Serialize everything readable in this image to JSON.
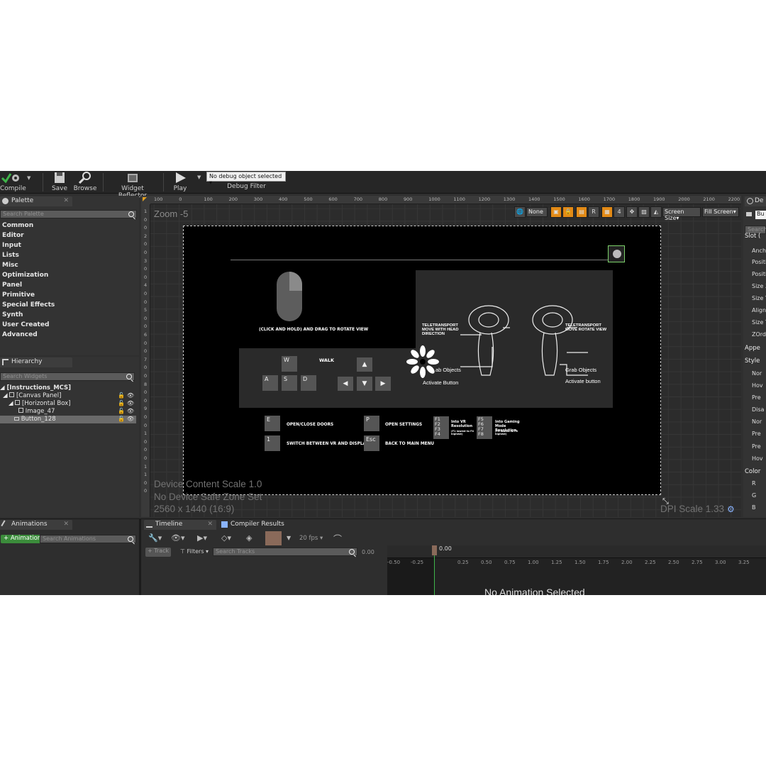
{
  "toolbar": {
    "compile": "Compile",
    "save": "Save",
    "browse": "Browse",
    "widget_reflector": "Widget Reflector",
    "play": "Play",
    "debug_object": "No debug object selected",
    "debug_filter": "Debug Filter"
  },
  "palette": {
    "tab": "Palette",
    "search_placeholder": "Search Palette",
    "items": [
      "Common",
      "Editor",
      "Input",
      "Lists",
      "Misc",
      "Optimization",
      "Panel",
      "Primitive",
      "Special Effects",
      "Synth",
      "User Created",
      "Advanced"
    ]
  },
  "hierarchy": {
    "tab": "Hierarchy",
    "search_placeholder": "Search Widgets",
    "rows": [
      "[Instructions_MCS]",
      "[Canvas Panel]",
      "[Horizontal Box]",
      "Image_47",
      "Button_128"
    ]
  },
  "designer": {
    "zoom": "Zoom -5",
    "ruler_ticks": [
      "100",
      "0",
      "100",
      "200",
      "300",
      "400",
      "500",
      "600",
      "700",
      "800",
      "900",
      "1000",
      "1100",
      "1200",
      "1300",
      "1400",
      "1500",
      "1600",
      "1700",
      "1800",
      "1900",
      "2000",
      "2100",
      "2200"
    ],
    "ruler_vticks": [
      "1",
      "0",
      "0",
      "2",
      "0",
      "0",
      "3",
      "0",
      "0",
      "4",
      "0",
      "0",
      "5",
      "0",
      "0",
      "6",
      "0",
      "0",
      "7",
      "0",
      "0",
      "8",
      "0",
      "0",
      "9",
      "0",
      "0",
      "1",
      "0",
      "0",
      "0",
      "1",
      "1",
      "0",
      "0"
    ],
    "view_none": "None",
    "view_r": "R",
    "view_4": "4",
    "screen_size": "Screen Size",
    "fill_screen": "Fill Screen",
    "device_content_scale": "Device Content Scale 1.0",
    "safe_zone": "No Device Safe Zone Set",
    "resolution": "2560 x 1440 (16:9)",
    "dpi_scale": "DPI Scale 1.33"
  },
  "instructions": {
    "mouse_text": "(CLICK AND HOLD) AND DRAG TO ROTATE VIEW",
    "walk": "WALK",
    "keys": [
      "W",
      "A",
      "S",
      "D"
    ],
    "arrows": [
      "▲",
      "◀",
      "▼",
      "▶"
    ],
    "tele_left": "TELETRANSPORT MOVE WITH HEAD DIRECTION",
    "tele_right": "TELETRANSPORT MOVE ROTATE VIEW",
    "grab_left": "ab Objects",
    "activate_left": "Activate Button",
    "grab_right": "Grab Objects",
    "activate_right": "Activate button",
    "key_e": "E",
    "open_close": "OPEN/CLOSE  DOORS",
    "key_p": "P",
    "open_settings": "OPEN SETTINGS",
    "key_1": "1",
    "switch_vr": "SWITCH BETWEEN VR AND DISPLAY",
    "key_esc": "Esc",
    "back_menu": "BACK TO MAIN MENU",
    "f1_keys": "F1\nF2\nF3\nF4",
    "vr_res": "Into VR Resolution",
    "vr_res_note": "(F1 lowest to F4 highest)",
    "f5_keys": "F5\nF6\nF7\nF8",
    "gaming_res": "Into Gaming Mode Resolution",
    "gaming_res_note": "(F5 lowest to F8 highest)"
  },
  "details": {
    "tab": "De",
    "button": "Bu",
    "search": "Search",
    "rows": [
      "Slot (",
      "Ancho",
      "Positi",
      "Positi",
      "Size X",
      "Size Y",
      "Align",
      "Size T",
      "ZOrde",
      "Appe",
      "Style",
      "Nor",
      "Hov",
      "Pre",
      "Disa",
      "Nor",
      "Pre",
      "Pre",
      "Hov",
      "Color",
      "R",
      "G",
      "B"
    ]
  },
  "animations": {
    "tab": "Animations",
    "add": "+ Animation",
    "search_placeholder": "Search Animations"
  },
  "timeline": {
    "tab_timeline": "Timeline",
    "tab_compiler": "Compiler Results",
    "fps": "20 fps",
    "track": "+ Track",
    "filters": "Filters",
    "search_tracks": "Search Tracks",
    "time_value": "0.00",
    "playhead": "0.00",
    "ticks": [
      "-0.50",
      "-0.25",
      "0.25",
      "0.50",
      "0.75",
      "1.00",
      "1.25",
      "1.50",
      "1.75",
      "2.00",
      "2.25",
      "2.50",
      "2.75",
      "3.00",
      "3.25"
    ],
    "no_animation": "No Animation Selected"
  },
  "colors": {
    "accent_orange": "#e28a16",
    "green": "#3b8c3b",
    "panel": "#333333",
    "canvas": "#000000"
  }
}
